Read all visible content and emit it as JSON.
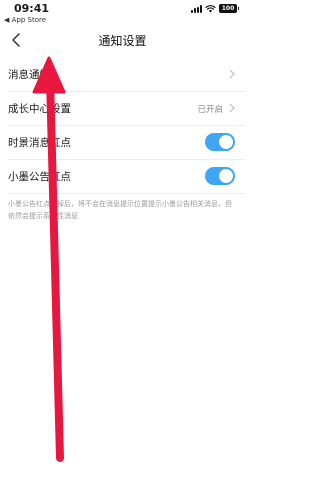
{
  "status_bar": {
    "time": "09:41",
    "back_app": "◀ App Store",
    "battery": "100"
  },
  "nav": {
    "title": "通知设置"
  },
  "settings": {
    "rows": [
      {
        "label": "消息通知",
        "status": "",
        "control": "chevron"
      },
      {
        "label": "成长中心设置",
        "status": "已开启",
        "control": "chevron"
      },
      {
        "label": "时景消息红点",
        "status": "",
        "control": "toggle",
        "on": true
      },
      {
        "label": "小墨公告红点",
        "status": "",
        "control": "toggle",
        "on": true
      }
    ]
  },
  "footnote": "小墨公告红点关掉后，将不会在消息提示位置提示小墨公告相关消息，但依然会提示系统性消息",
  "annotation": {
    "arrow_color": "#e8173f"
  },
  "colors": {
    "toggle_on": "#3ea6f5",
    "text_primary": "#1a1a1a",
    "text_secondary": "#888888"
  }
}
